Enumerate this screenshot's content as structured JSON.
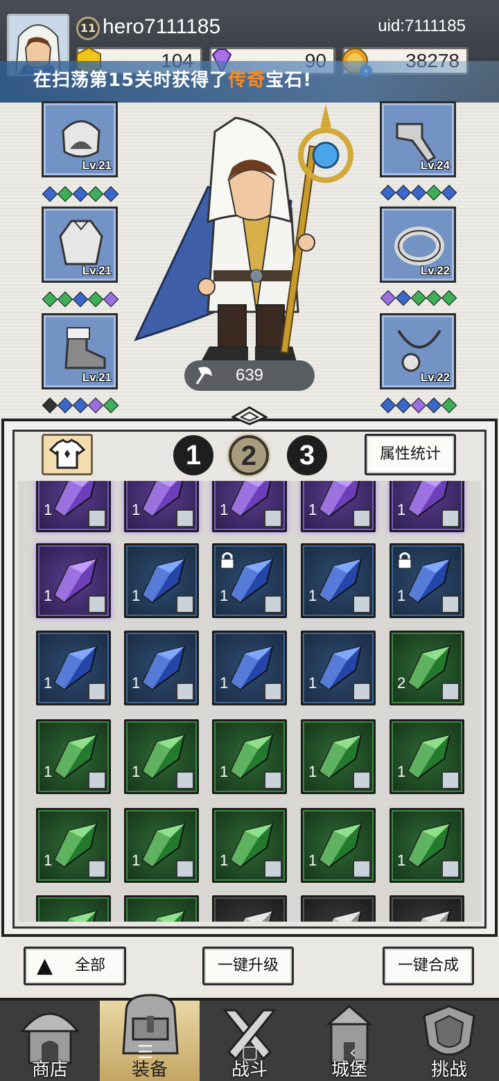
{
  "header": {
    "player_level": "11",
    "player_name": "hero7111185",
    "uid": "uid:7111185",
    "currencies": [
      {
        "name": "energy",
        "icon": "gold-hexagon-icon",
        "value": "104",
        "color": "#f0c419"
      },
      {
        "name": "gems",
        "icon": "purple-gem-icon",
        "value": "90",
        "color": "#a970e8"
      },
      {
        "name": "coins",
        "icon": "gold-coin-icon",
        "value": "38278",
        "color": "#e2a32a"
      }
    ]
  },
  "banner": {
    "prefix": "在扫荡第15关时获得了",
    "highlight": "传奇",
    "suffix": "宝石!",
    "highlight_color": "#ff8a1c"
  },
  "equipment": {
    "left": [
      {
        "slot": "hood",
        "icon": "hood-icon",
        "level": "Lv.21",
        "gems": [
          "blue",
          "green",
          "blue",
          "green",
          "blue"
        ]
      },
      {
        "slot": "robe",
        "icon": "robe-icon",
        "level": "Lv.21",
        "gems": [
          "green",
          "green",
          "blue",
          "green",
          "purple"
        ]
      },
      {
        "slot": "boots",
        "icon": "boot-icon",
        "level": "Lv.21",
        "gems": [
          "black",
          "blue",
          "blue",
          "purple",
          "green"
        ]
      }
    ],
    "right": [
      {
        "slot": "weapon",
        "icon": "pipe-icon",
        "level": "Lv.24",
        "gems": [
          "blue",
          "blue",
          "blue",
          "green",
          "blue"
        ]
      },
      {
        "slot": "ring",
        "icon": "ring-icon",
        "level": "Lv.22",
        "gems": [
          "purple",
          "blue",
          "green",
          "green",
          "green"
        ]
      },
      {
        "slot": "necklace",
        "icon": "necklace-icon",
        "level": "Lv.22",
        "gems": [
          "blue",
          "blue",
          "purple",
          "blue",
          "green"
        ]
      }
    ],
    "power": "639"
  },
  "colors": {
    "purple": "#9b6fe0",
    "blue": "#3a67c9",
    "green": "#3fae58",
    "black": "#333333",
    "slot_bg": "#7393c4"
  },
  "inventory": {
    "pages": [
      "1",
      "2",
      "3"
    ],
    "active_page": "2",
    "stats_button": "属性统计",
    "rows": [
      [
        {
          "tier": "purple",
          "count": "1",
          "type": "staff-type-icon"
        },
        {
          "tier": "purple",
          "count": "1",
          "type": "hood-type-icon"
        },
        {
          "tier": "purple",
          "count": "1",
          "type": "hood-type-icon"
        },
        {
          "tier": "purple",
          "count": "1",
          "type": "necklace-type-icon"
        },
        {
          "tier": "purple",
          "count": "1",
          "type": "necklace-type-icon"
        }
      ],
      [
        {
          "tier": "purple",
          "count": "1",
          "type": "necklace-type-icon",
          "locked": false
        },
        {
          "tier": "blue",
          "count": "1",
          "type": "ring-type-icon",
          "locked": false
        },
        {
          "tier": "blue",
          "count": "1",
          "type": "ring-type-icon",
          "locked": true
        },
        {
          "tier": "blue",
          "count": "1",
          "type": "boot-type-icon",
          "locked": false
        },
        {
          "tier": "blue",
          "count": "1",
          "type": "staff-type-icon",
          "locked": true
        }
      ],
      [
        {
          "tier": "blue",
          "count": "1",
          "type": "staff-type-icon"
        },
        {
          "tier": "blue",
          "count": "1",
          "type": "staff-type-icon"
        },
        {
          "tier": "blue",
          "count": "1",
          "type": "necklace-type-icon"
        },
        {
          "tier": "blue",
          "count": "1",
          "type": "necklace-type-icon"
        },
        {
          "tier": "green",
          "count": "2",
          "type": "ring-type-icon"
        }
      ],
      [
        {
          "tier": "green",
          "count": "1",
          "type": "ring-type-icon"
        },
        {
          "tier": "green",
          "count": "1",
          "type": "ring-type-icon"
        },
        {
          "tier": "green",
          "count": "1",
          "type": "robe-type-icon"
        },
        {
          "tier": "green",
          "count": "1",
          "type": "robe-type-icon"
        },
        {
          "tier": "green",
          "count": "1",
          "type": "boot-type-icon"
        }
      ],
      [
        {
          "tier": "green",
          "count": "1",
          "type": "boot-type-icon"
        },
        {
          "tier": "green",
          "count": "1",
          "type": "staff-type-icon"
        },
        {
          "tier": "green",
          "count": "1",
          "type": "hood-type-icon"
        },
        {
          "tier": "green",
          "count": "1",
          "type": "hood-type-icon"
        },
        {
          "tier": "green",
          "count": "1",
          "type": "hood-type-icon"
        }
      ],
      [
        {
          "tier": "green",
          "count": "",
          "type": ""
        },
        {
          "tier": "green",
          "count": "",
          "type": ""
        },
        {
          "tier": "gray",
          "count": "",
          "type": ""
        },
        {
          "tier": "gray",
          "count": "",
          "type": ""
        },
        {
          "tier": "gray",
          "count": "",
          "type": ""
        }
      ]
    ]
  },
  "actions": {
    "filter": "全部",
    "upgrade_all": "一键升级",
    "merge_all": "一键合成"
  },
  "nav": [
    {
      "label": "商店",
      "icon": "shop-hut-icon",
      "active": false
    },
    {
      "label": "装备",
      "icon": "backpack-icon",
      "active": true
    },
    {
      "label": "战斗",
      "icon": "crossed-swords-icon",
      "active": false
    },
    {
      "label": "城堡",
      "icon": "castle-icon",
      "active": false
    },
    {
      "label": "挑战",
      "icon": "shield-crest-icon",
      "active": false
    }
  ],
  "system_nav": {
    "menu": "☰",
    "home": "▢",
    "back": "‹"
  }
}
